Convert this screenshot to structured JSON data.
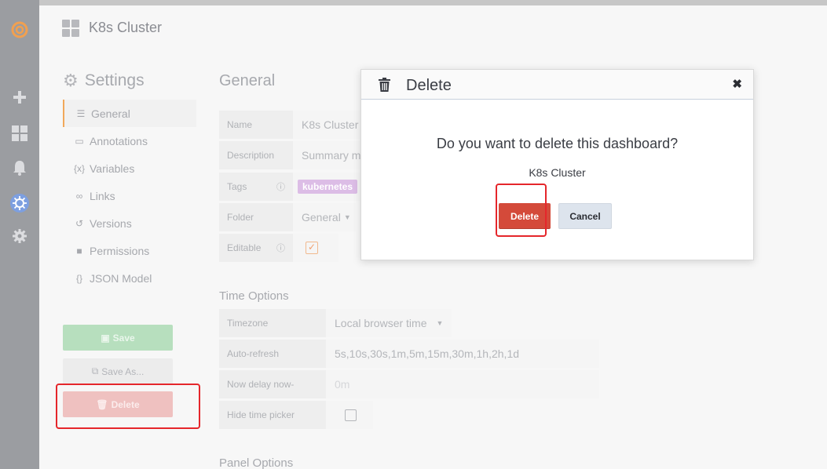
{
  "colors": {
    "accent_orange": "#f1a85a",
    "danger": "#d44a3a",
    "highlight_red": "#e5262b",
    "rail": "#9b9da1"
  },
  "rail": {
    "icons": [
      "grafana-logo-icon",
      "plus-icon",
      "dashboards-icon",
      "bell-icon",
      "kubernetes-icon",
      "gear-icon"
    ]
  },
  "header": {
    "title": "K8s Cluster"
  },
  "settings": {
    "title": "Settings",
    "nav": [
      {
        "label": "General",
        "icon": "sliders-icon",
        "active": true
      },
      {
        "label": "Annotations",
        "icon": "comment-icon",
        "active": false
      },
      {
        "label": "Variables",
        "icon": "variables-icon",
        "active": false
      },
      {
        "label": "Links",
        "icon": "link-icon",
        "active": false
      },
      {
        "label": "Versions",
        "icon": "history-icon",
        "active": false
      },
      {
        "label": "Permissions",
        "icon": "lock-icon",
        "active": false
      },
      {
        "label": "JSON Model",
        "icon": "json-icon",
        "active": false
      }
    ],
    "save_label": "Save",
    "save_as_label": "Save As...",
    "delete_label": "Delete"
  },
  "general": {
    "title": "General",
    "name_label": "Name",
    "name_value": "K8s Cluster",
    "description_label": "Description",
    "description_value": "Summary m",
    "tags_label": "Tags",
    "tag": "kubernetes",
    "folder_label": "Folder",
    "folder_value": "General",
    "editable_label": "Editable",
    "editable_checked": true
  },
  "time_options": {
    "title": "Time Options",
    "timezone_label": "Timezone",
    "timezone_value": "Local browser time",
    "autorefresh_label": "Auto-refresh",
    "autorefresh_value": "5s,10s,30s,1m,5m,15m,30m,1h,2h,1d",
    "nowdelay_label": "Now delay now-",
    "nowdelay_placeholder": "0m",
    "hidepicker_label": "Hide time picker",
    "hidepicker_checked": false
  },
  "panel_options": {
    "title": "Panel Options"
  },
  "modal": {
    "title": "Delete",
    "question": "Do you want to delete this dashboard?",
    "dashboard_name": "K8s Cluster",
    "delete_label": "Delete",
    "cancel_label": "Cancel",
    "close_glyph": "✖"
  }
}
